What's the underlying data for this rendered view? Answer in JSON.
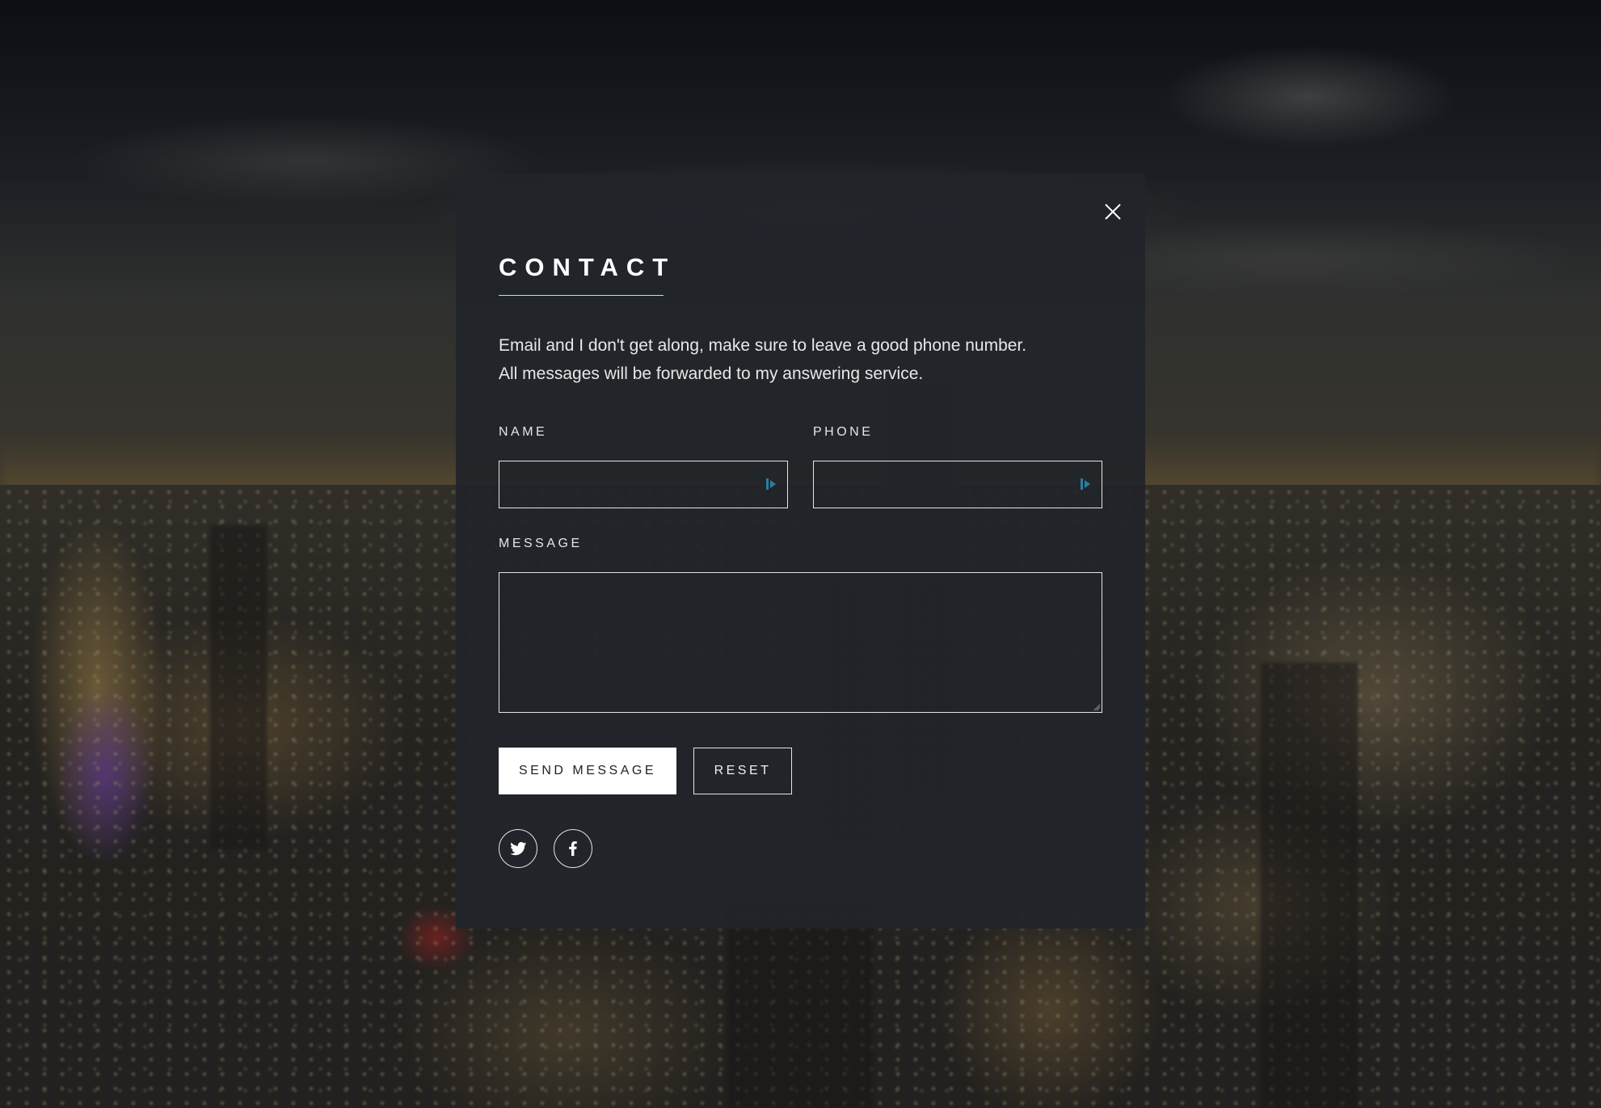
{
  "modal": {
    "title": "CONTACT",
    "intro_lines": [
      "Email and I don't get along, make sure to leave a good phone number.",
      "All messages will be forwarded to my answering service."
    ],
    "close_icon": "close-icon"
  },
  "form": {
    "name": {
      "label": "NAME",
      "value": "",
      "placeholder": ""
    },
    "phone": {
      "label": "PHONE",
      "value": "",
      "placeholder": ""
    },
    "message": {
      "label": "MESSAGE",
      "value": "",
      "placeholder": ""
    },
    "submit_label": "SEND MESSAGE",
    "reset_label": "RESET"
  },
  "social": [
    {
      "name": "twitter",
      "icon": "twitter-icon"
    },
    {
      "name": "facebook",
      "icon": "facebook-icon"
    }
  ],
  "colors": {
    "modal_bg": "#212429",
    "text": "#ffffff",
    "autofill_icon": "#2a7ea8"
  }
}
